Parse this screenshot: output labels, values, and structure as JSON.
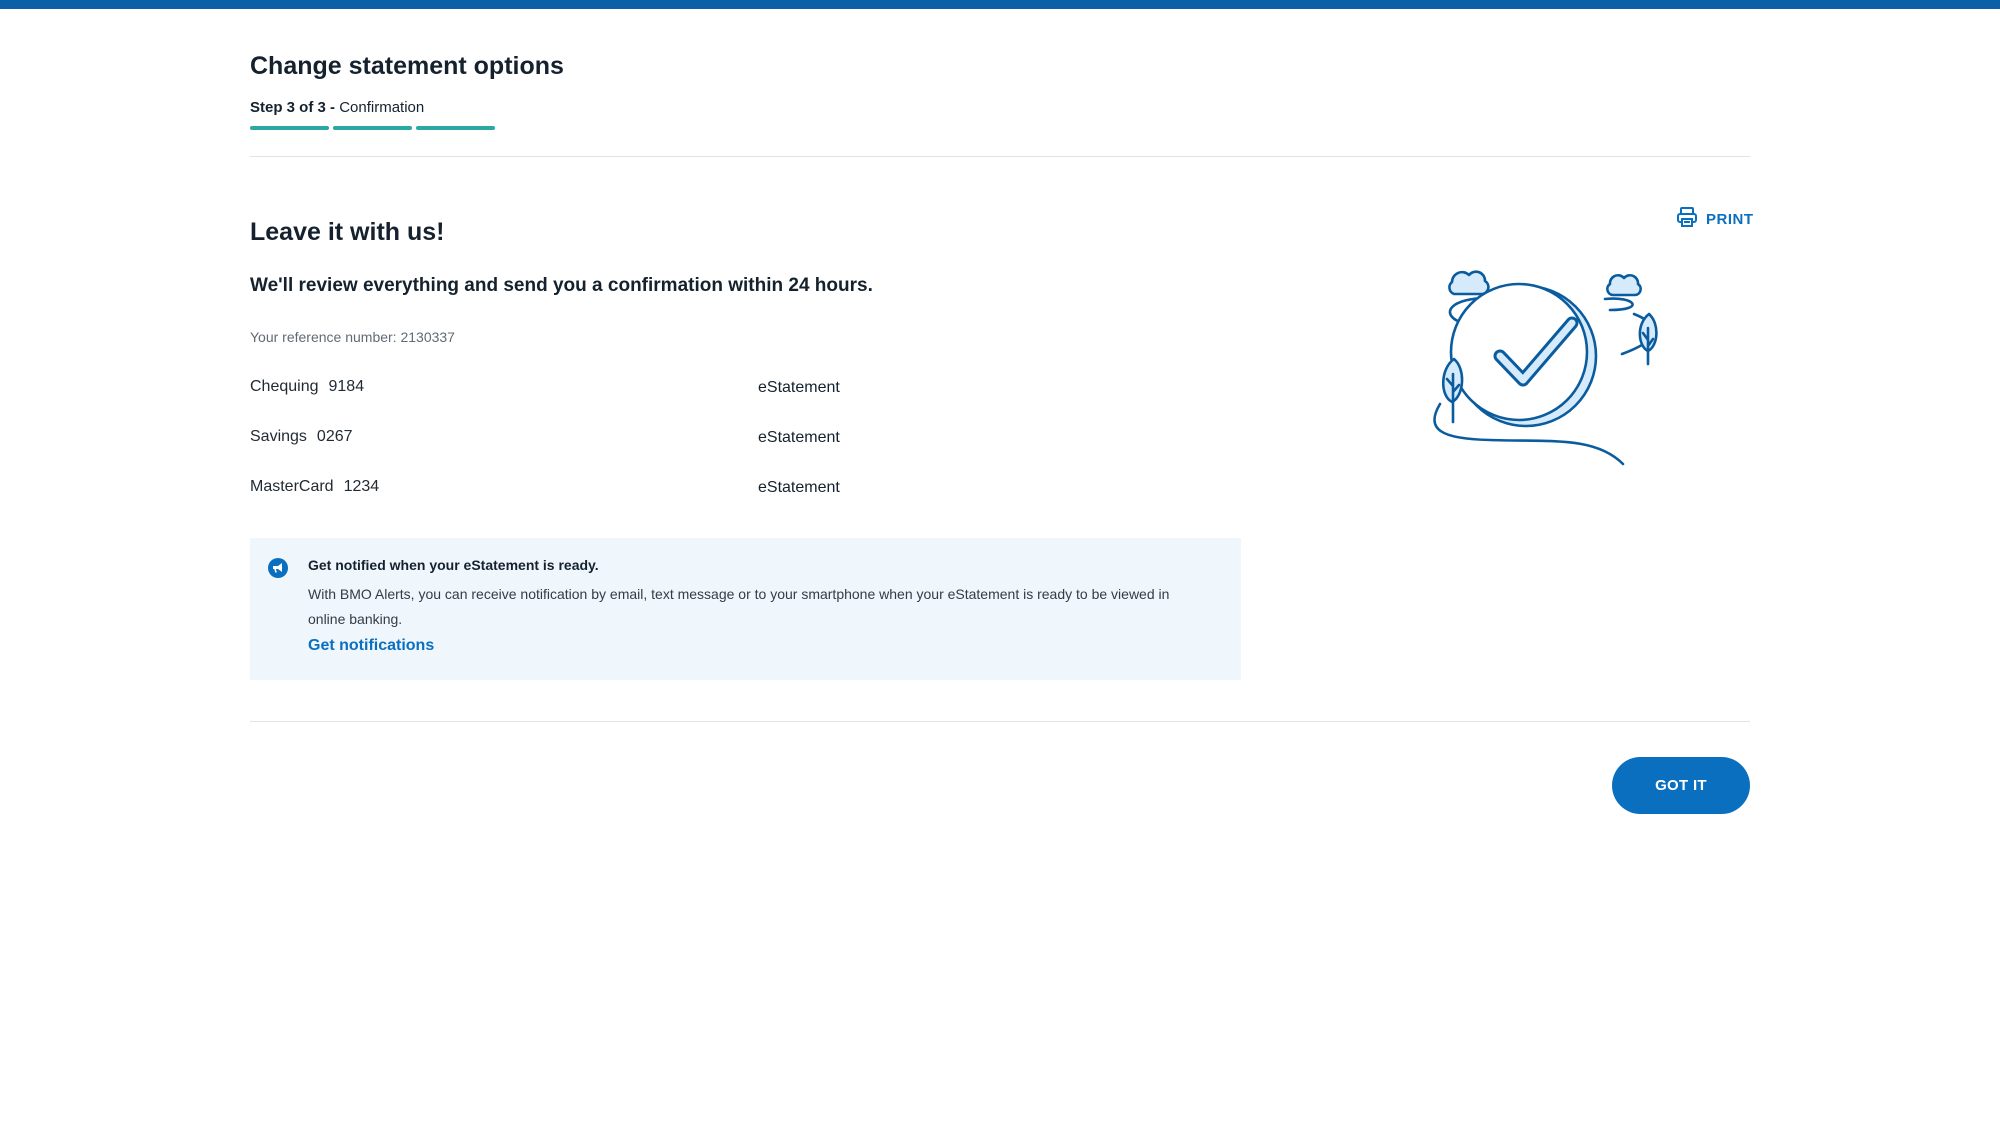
{
  "colors": {
    "brand_blue": "#0b6fbf",
    "top_bar": "#0a5fa8",
    "progress_teal": "#2aa8a3",
    "notice_bg": "#eff7fc"
  },
  "header": {
    "title": "Change statement options",
    "step_number": "Step 3 of 3",
    "step_separator": " - ",
    "step_name": "Confirmation",
    "progress": {
      "current_step": 3,
      "total_steps": 3
    }
  },
  "print": {
    "icon": "printer-icon",
    "label": "PRINT"
  },
  "confirmation": {
    "heading": "Leave it with us!",
    "subheading": "We'll review everything and send you a confirmation within 24 hours.",
    "reference": "Your reference number: 2130337",
    "accounts": [
      {
        "name": "Chequing",
        "number": "9184",
        "value": "eStatement"
      },
      {
        "name": "Savings",
        "number": "0267",
        "value": "eStatement"
      },
      {
        "name": "MasterCard",
        "number": "1234",
        "value": "eStatement"
      }
    ]
  },
  "notice": {
    "icon": "megaphone-icon",
    "title": "Get notified when your eStatement is ready.",
    "body": "With BMO Alerts, you can receive notification by email, text message or to your smartphone when your eStatement is ready to be viewed in online banking.",
    "link_label": "Get notifications"
  },
  "illustration": {
    "icon": "success-checkmark-illustration"
  },
  "footer": {
    "primary_button_label": "GOT IT"
  }
}
